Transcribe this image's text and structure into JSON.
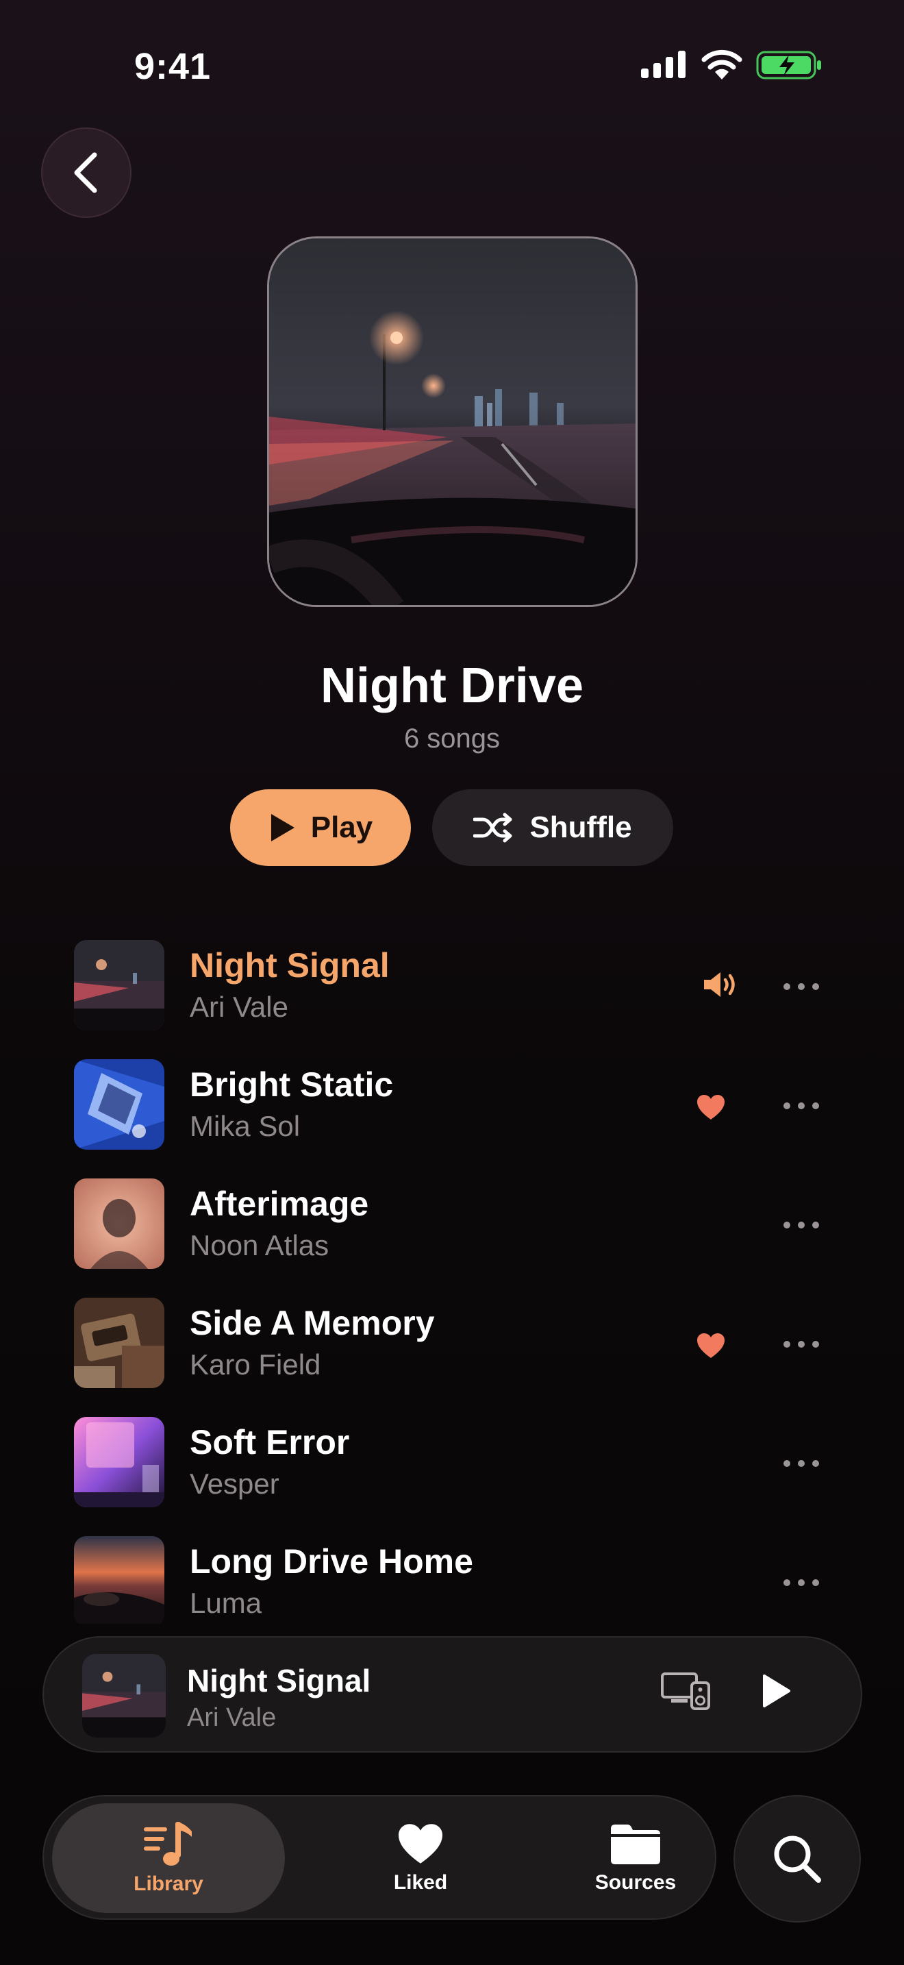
{
  "status_bar": {
    "time": "9:41"
  },
  "playlist": {
    "title": "Night Drive",
    "subtitle": "6 songs"
  },
  "actions": {
    "play_label": "Play",
    "shuffle_label": "Shuffle"
  },
  "tracks": [
    {
      "title": "Night Signal",
      "artist": "Ari Vale",
      "state": "playing",
      "liked": false
    },
    {
      "title": "Bright Static",
      "artist": "Mika Sol",
      "state": "idle",
      "liked": true
    },
    {
      "title": "Afterimage",
      "artist": "Noon Atlas",
      "state": "idle",
      "liked": false
    },
    {
      "title": "Side A Memory",
      "artist": "Karo Field",
      "state": "idle",
      "liked": true
    },
    {
      "title": "Soft Error",
      "artist": "Vesper",
      "state": "idle",
      "liked": false
    },
    {
      "title": "Long Drive Home",
      "artist": "Luma",
      "state": "idle",
      "liked": false
    }
  ],
  "mini_player": {
    "title": "Night Signal",
    "artist": "Ari Vale"
  },
  "tab_bar": {
    "tabs": [
      {
        "label": "Library",
        "icon": "music-library-icon",
        "active": true
      },
      {
        "label": "Liked",
        "icon": "heart-icon",
        "active": false
      },
      {
        "label": "Sources",
        "icon": "folder-icon",
        "active": false
      }
    ],
    "search_icon": "search-icon"
  },
  "colors": {
    "accent": "#f6a66a",
    "heart": "#f27a5e",
    "battery": "#4cd964"
  }
}
